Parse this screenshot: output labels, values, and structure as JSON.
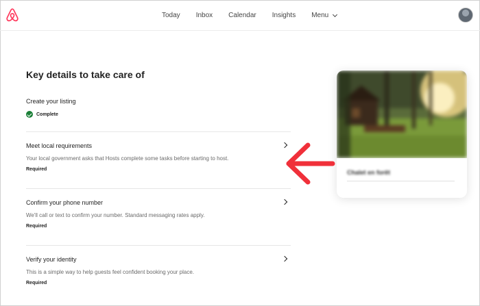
{
  "header": {
    "logo_icon": "airbnb-logo-icon",
    "nav": [
      {
        "label": "Today"
      },
      {
        "label": "Inbox"
      },
      {
        "label": "Calendar"
      },
      {
        "label": "Insights"
      },
      {
        "label": "Menu"
      }
    ],
    "avatar_icon": "user-avatar"
  },
  "main": {
    "title": "Key details to take care of",
    "tasks": [
      {
        "label": "Create your listing",
        "status": "Complete"
      },
      {
        "label": "Meet local requirements",
        "description": "Your local government asks that Hosts complete some tasks before starting to host.",
        "tag": "Required"
      },
      {
        "label": "Confirm your phone number",
        "description": "We'll call or text to confirm your number. Standard messaging rates apply.",
        "tag": "Required"
      },
      {
        "label": "Verify your identity",
        "description": "This is a simple way to help guests feel confident booking your place.",
        "tag": "Required"
      }
    ]
  },
  "listing_card": {
    "title": "Chalet en forêt"
  },
  "colors": {
    "brand": "#ff385c",
    "success": "#1a7f37",
    "annotation": "#f0303a",
    "text": "#222222",
    "muted": "#6a6a6a"
  }
}
